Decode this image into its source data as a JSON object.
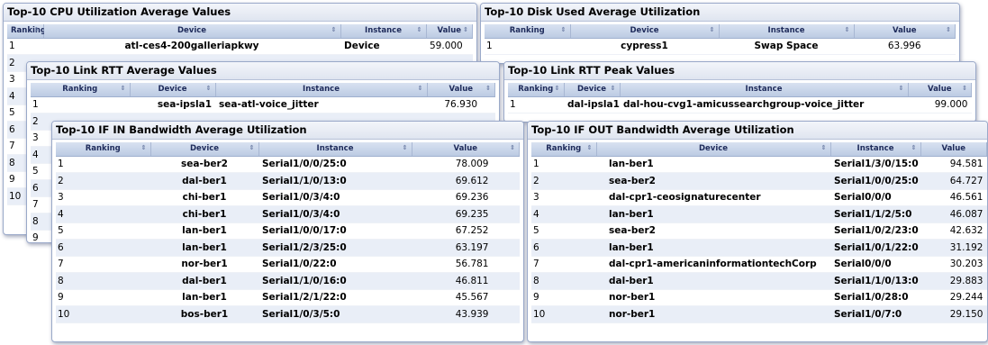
{
  "panels": {
    "cpu": {
      "title": "Top-10 CPU Utilization Average Values",
      "headers": {
        "ranking": "Ranking",
        "device": "Device",
        "instance": "Instance",
        "value": "Value"
      },
      "rows": [
        {
          "ranking": "1",
          "device": "atl-ces4-200galleriapkwy",
          "instance": "Device",
          "value": "59.000"
        }
      ],
      "hidden_rankings": [
        "2",
        "3",
        "4",
        "5",
        "6",
        "7",
        "8",
        "9",
        "10"
      ]
    },
    "disk": {
      "title": "Top-10 Disk Used Average Utilization",
      "headers": {
        "ranking": "Ranking",
        "device": "Device",
        "instance": "Instance",
        "value": "Value"
      },
      "rows": [
        {
          "ranking": "1",
          "device": "cypress1",
          "instance": "Swap Space",
          "value": "63.996"
        }
      ]
    },
    "rtt_avg": {
      "title": "Top-10 Link RTT Average Values",
      "headers": {
        "ranking": "Ranking",
        "device": "Device",
        "instance": "Instance",
        "value": "Value"
      },
      "rows": [
        {
          "ranking": "1",
          "device": "sea-ipsla1",
          "instance": "sea-atl-voice_jitter",
          "value": "76.930"
        }
      ],
      "hidden_rankings": [
        "2",
        "3",
        "4",
        "5",
        "6",
        "7",
        "8",
        "9",
        "10"
      ]
    },
    "rtt_peak": {
      "title": "Top-10 Link RTT Peak Values",
      "headers": {
        "ranking": "Ranking",
        "device": "Device",
        "instance": "Instance",
        "value": "Value"
      },
      "rows": [
        {
          "ranking": "1",
          "device": "dal-ipsla1",
          "instance": "dal-hou-cvg1-amicussearchgroup-voice_jitter",
          "value": "99.000"
        }
      ]
    },
    "if_in": {
      "title": "Top-10 IF IN Bandwidth Average Utilization",
      "headers": {
        "ranking": "Ranking",
        "device": "Device",
        "instance": "Instance",
        "value": "Value"
      },
      "rows": [
        {
          "ranking": "1",
          "device": "sea-ber2",
          "instance": "Serial1/0/0/25:0",
          "value": "78.009"
        },
        {
          "ranking": "2",
          "device": "dal-ber1",
          "instance": "Serial1/1/0/13:0",
          "value": "69.612"
        },
        {
          "ranking": "3",
          "device": "chi-ber1",
          "instance": "Serial1/0/3/4:0",
          "value": "69.236"
        },
        {
          "ranking": "4",
          "device": "chi-ber1",
          "instance": "Serial1/0/3/4:0",
          "value": "69.235"
        },
        {
          "ranking": "5",
          "device": "lan-ber1",
          "instance": "Serial1/0/0/17:0",
          "value": "67.252"
        },
        {
          "ranking": "6",
          "device": "lan-ber1",
          "instance": "Serial1/2/3/25:0",
          "value": "63.197"
        },
        {
          "ranking": "7",
          "device": "nor-ber1",
          "instance": "Serial1/0/22:0",
          "value": "56.781"
        },
        {
          "ranking": "8",
          "device": "dal-ber1",
          "instance": "Serial1/1/0/16:0",
          "value": "46.811"
        },
        {
          "ranking": "9",
          "device": "lan-ber1",
          "instance": "Serial1/2/1/22:0",
          "value": "45.567"
        },
        {
          "ranking": "10",
          "device": "bos-ber1",
          "instance": "Serial1/0/3/5:0",
          "value": "43.939"
        }
      ]
    },
    "if_out": {
      "title": "Top-10 IF OUT Bandwidth Average Utilization",
      "headers": {
        "ranking": "Ranking",
        "device": "Device",
        "instance": "Instance",
        "value": "Value"
      },
      "rows": [
        {
          "ranking": "1",
          "device": "lan-ber1",
          "instance": "Serial1/3/0/15:0",
          "value": "94.581"
        },
        {
          "ranking": "2",
          "device": "sea-ber2",
          "instance": "Serial1/0/0/25:0",
          "value": "64.727"
        },
        {
          "ranking": "3",
          "device": "dal-cpr1-ceosignaturecenter",
          "instance": "Serial0/0/0",
          "value": "46.561"
        },
        {
          "ranking": "4",
          "device": "lan-ber1",
          "instance": "Serial1/1/2/5:0",
          "value": "46.087"
        },
        {
          "ranking": "5",
          "device": "sea-ber2",
          "instance": "Serial1/0/2/23:0",
          "value": "42.632"
        },
        {
          "ranking": "6",
          "device": "lan-ber1",
          "instance": "Serial1/0/1/22:0",
          "value": "31.192"
        },
        {
          "ranking": "7",
          "device": "dal-cpr1-americaninformationtechCorp",
          "instance": "Serial0/0/0",
          "value": "30.203"
        },
        {
          "ranking": "8",
          "device": "dal-ber1",
          "instance": "Serial1/1/0/13:0",
          "value": "29.883"
        },
        {
          "ranking": "9",
          "device": "nor-ber1",
          "instance": "Serial1/0/28:0",
          "value": "29.244"
        },
        {
          "ranking": "10",
          "device": "nor-ber1",
          "instance": "Serial1/0/7:0",
          "value": "29.150"
        }
      ]
    }
  }
}
